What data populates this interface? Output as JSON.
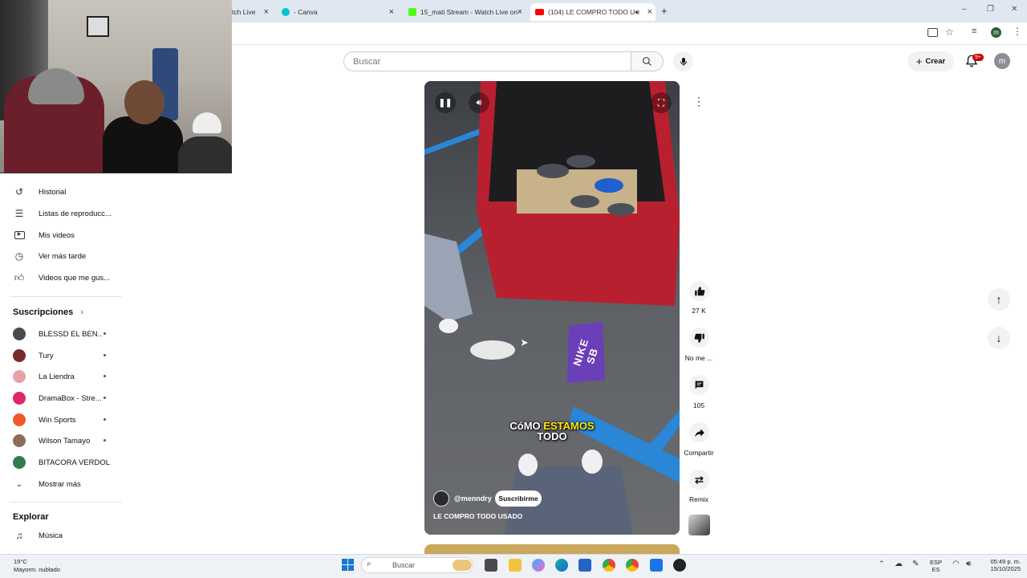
{
  "browser": {
    "tabs": [
      {
        "label": "tch Live",
        "favicon_color": "#6441a5"
      },
      {
        "label": "- Canva",
        "favicon_color": "#00c4cc"
      },
      {
        "label": "15_mati Stream - Watch Live on",
        "favicon_color": "#53fc18"
      },
      {
        "label": "(104) LE COMPRO TODO U",
        "favicon_color": "#ff0000"
      }
    ],
    "new_tab_symbol": "+",
    "profile_initial": "m"
  },
  "header": {
    "search_placeholder": "Buscar",
    "create_label": "Crear",
    "notifications_badge": "9+",
    "avatar_initial": "m"
  },
  "sidebar": {
    "you_items": [
      {
        "label": "Historial",
        "icon": "history-icon"
      },
      {
        "label": "Listas de reproducc...",
        "icon": "playlist-icon"
      },
      {
        "label": "Mis videos",
        "icon": "my-videos-icon"
      },
      {
        "label": "Ver más tarde",
        "icon": "watch-later-icon"
      },
      {
        "label": "Videos que me gus...",
        "icon": "liked-icon"
      }
    ],
    "subscriptions_title": "Suscripciones",
    "subscriptions": [
      {
        "label": "BLESSD EL BEN...",
        "color": "#4a4a4a"
      },
      {
        "label": "Tury",
        "color": "#7a2a2a"
      },
      {
        "label": "La Liendra",
        "color": "#e8a0a8"
      },
      {
        "label": "DramaBox - Stre...",
        "color": "#e0266b"
      },
      {
        "label": "Win Sports",
        "color": "#f05a28"
      },
      {
        "label": "Wilson Tamayo",
        "color": "#8c6d5a"
      },
      {
        "label": "BITACORA VERDOL...",
        "color": "#2e7d4f"
      }
    ],
    "show_more_label": "Mostrar más",
    "explore_title": "Explorar",
    "explore_items": [
      {
        "label": "Música",
        "icon": "music-icon"
      }
    ]
  },
  "short": {
    "caption_word1": "CóMO",
    "caption_word2": "ESTAMOS",
    "caption_word3": "TODO",
    "box_text": "NIKE SB",
    "channel_handle": "@menndry",
    "subscribe_label": "Suscribirme",
    "title": "LE COMPRO TODO USADO"
  },
  "actions": {
    "like_count": "27 K",
    "dislike_label": "No me ...",
    "comments_count": "105",
    "share_label": "Compartir",
    "remix_label": "Remix"
  },
  "taskbar": {
    "weather_temp": "19°C",
    "weather_desc": "Mayorm. nublado",
    "search_placeholder": "Buscar",
    "lang_line1": "ESP",
    "lang_line2": "ES",
    "time": "05:49 p. m.",
    "date": "15/10/2025"
  },
  "colors": {
    "accent": "#ff0000",
    "tabbar": "#dfe7f0",
    "caption_yellow": "#ffe600"
  }
}
